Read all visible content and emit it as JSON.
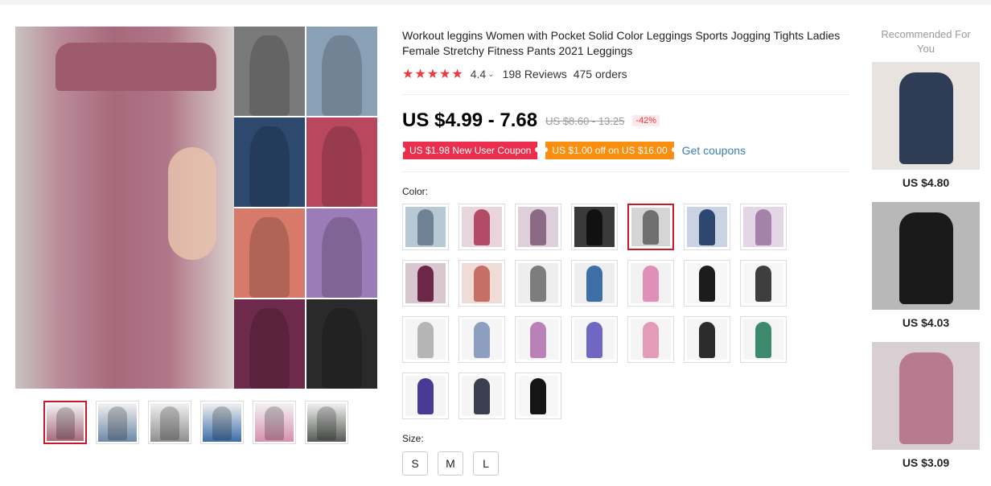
{
  "product": {
    "title": "Workout leggins Women with Pocket Solid Color Leggings Sports Jogging Tights Ladies Female Stretchy Fitness Pants 2021 Leggings",
    "stars": "★★★★★",
    "rating": "4.4",
    "reviews": "198 Reviews",
    "orders": "475 orders",
    "price": "US $4.99 - 7.68",
    "old_price": "US $8.60 - 13.25",
    "discount": "-42%",
    "coupons": [
      "US $1.98 New User Coupon",
      "US $1.00 off on US $16.00"
    ],
    "get_coupons": "Get coupons",
    "color_label": "Color:",
    "size_label": "Size:",
    "sizes": [
      "S",
      "M",
      "L"
    ]
  },
  "gallery": {
    "main_colors": [
      "#7a7a7a",
      "#8aa0b5",
      "#2d4a6e",
      "#b9485e",
      "#d77a6a",
      "#9c7cb8",
      "#6e2a4a",
      "#2a2a2a"
    ],
    "thumb_colors": [
      "#a86b7e",
      "#6d88a8",
      "#8e8e8e",
      "#3d6ea8",
      "#d88fae",
      "#555b55"
    ],
    "active_thumb": 0
  },
  "colors": {
    "swatches": [
      {
        "bg": "#b8c9d6",
        "leg": "#6f8295"
      },
      {
        "bg": "#e8d5dc",
        "leg": "#b34a66"
      },
      {
        "bg": "#ddd0da",
        "leg": "#8a6a85"
      },
      {
        "bg": "#3a3a3a",
        "leg": "#111111"
      },
      {
        "bg": "#d5d5d5",
        "leg": "#6f6f6f"
      },
      {
        "bg": "#c9d3e3",
        "leg": "#2e4770"
      },
      {
        "bg": "#e3d7e6",
        "leg": "#a582a8"
      },
      {
        "bg": "#d9c7cf",
        "leg": "#6b2947"
      },
      {
        "bg": "#f0dcd6",
        "leg": "#c56f66"
      },
      {
        "bg": "#eeeeee",
        "leg": "#7d7d7d"
      },
      {
        "bg": "#eeeeee",
        "leg": "#3d6ea8"
      },
      {
        "bg": "#f2f2f2",
        "leg": "#e08fb8"
      },
      {
        "bg": "#f7f7f7",
        "leg": "#1c1c1c"
      },
      {
        "bg": "#f7f7f7",
        "leg": "#3e3e3e"
      },
      {
        "bg": "#f5f5f5",
        "leg": "#b5b5b5"
      },
      {
        "bg": "#f5f5f5",
        "leg": "#8d9fc0"
      },
      {
        "bg": "#f5f5f5",
        "leg": "#b981b8"
      },
      {
        "bg": "#f5f5f5",
        "leg": "#6f67c2"
      },
      {
        "bg": "#f5f5f5",
        "leg": "#e39bb6"
      },
      {
        "bg": "#f5f5f5",
        "leg": "#2c2c2c"
      },
      {
        "bg": "#f5f5f5",
        "leg": "#3b8a6e"
      },
      {
        "bg": "#f5f5f5",
        "leg": "#4a3a96"
      },
      {
        "bg": "#f5f5f5",
        "leg": "#3a4050"
      },
      {
        "bg": "#f7f7f7",
        "leg": "#151515"
      }
    ],
    "active_index": 4
  },
  "recommended": {
    "title": "Recommended For You",
    "items": [
      {
        "price": "US $4.80",
        "bg": "#e8e3de",
        "leg": "#2e3d55"
      },
      {
        "price": "US $4.03",
        "bg": "#b8b8b8",
        "leg": "#1a1a1a"
      },
      {
        "price": "US $3.09",
        "bg": "#d9cfd2",
        "leg": "#b87a8f"
      }
    ]
  },
  "accent_color": "#c8182c"
}
